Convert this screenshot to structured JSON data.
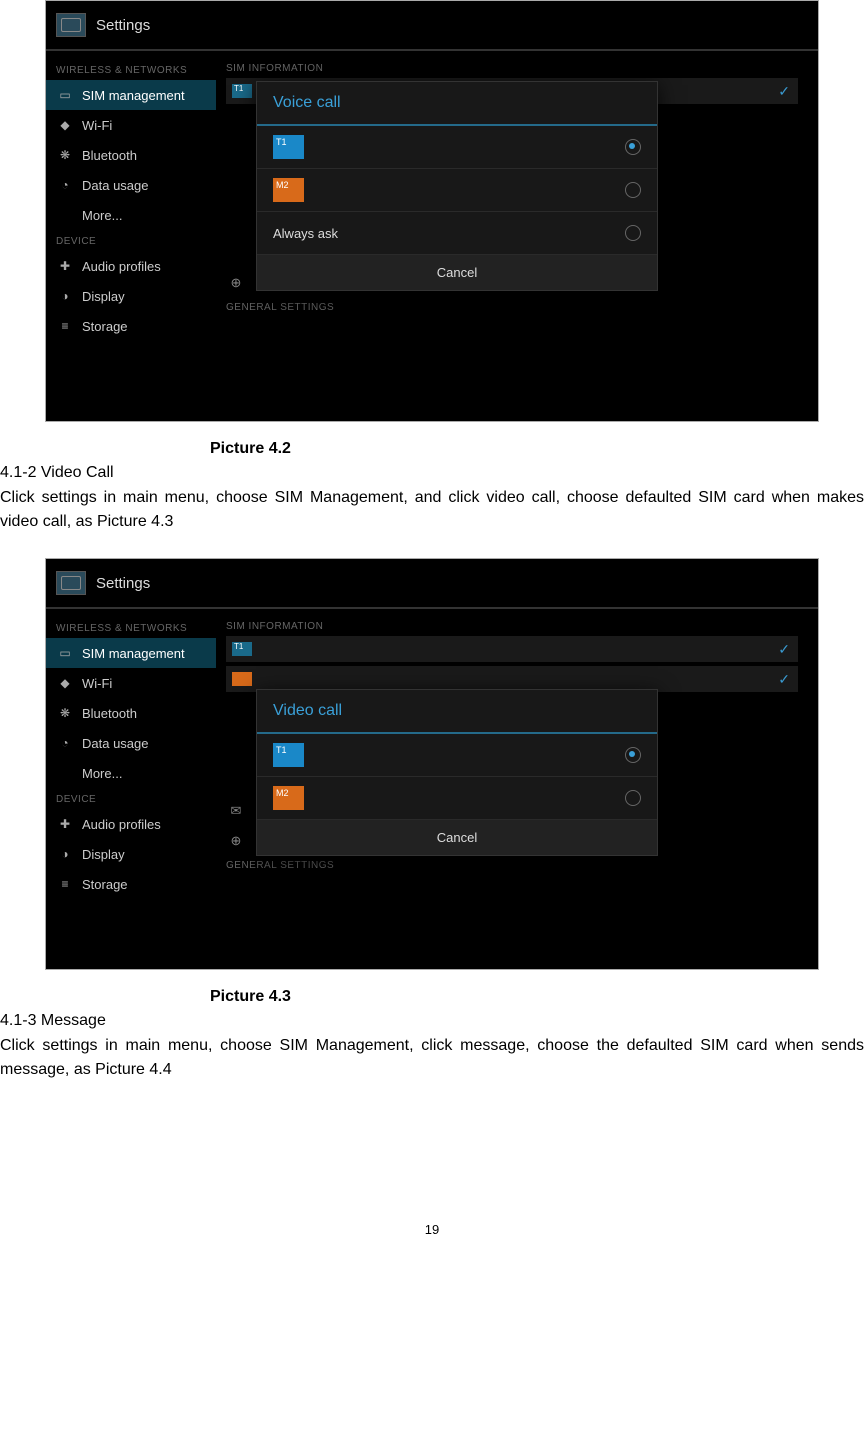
{
  "shot1": {
    "title": "Settings",
    "side_section1": "WIRELESS & NETWORKS",
    "side_items1": [
      "SIM management",
      "Wi-Fi",
      "Bluetooth",
      "Data usage",
      "More..."
    ],
    "side_section2": "DEVICE",
    "side_items2": [
      "Audio profiles",
      "Display",
      "Storage"
    ],
    "right_section": "SIM INFORMATION",
    "right_general": "GENERAL SETTINGS",
    "right_item": "Data connection",
    "dialog": {
      "title": "Voice call",
      "opt1": "T1",
      "opt2": "M2",
      "opt3": "Always ask",
      "cancel": "Cancel"
    }
  },
  "caption1": "Picture 4.2",
  "sect1_head": "4.1-2 Video Call",
  "sect1_body": "Click settings in main menu, choose SIM Management, and click video call, choose defaulted SIM card when makes video call, as Picture 4.3",
  "shot2": {
    "title": "Settings",
    "side_section1": "WIRELESS & NETWORKS",
    "side_items1": [
      "SIM management",
      "Wi-Fi",
      "Bluetooth",
      "Data usage",
      "More..."
    ],
    "side_section2": "DEVICE",
    "side_items2": [
      "Audio profiles",
      "Display",
      "Storage"
    ],
    "right_section": "SIM INFORMATION",
    "right_general": "GENERAL SETTINGS",
    "right_item1": "Messaging",
    "right_item2": "Data connection",
    "dialog": {
      "title": "Video call",
      "opt1": "T1",
      "opt2": "M2",
      "cancel": "Cancel"
    }
  },
  "caption2": "Picture 4.3",
  "sect2_head": "4.1-3 Message",
  "sect2_body": "Click settings in main menu, choose SIM Management, click message, choose the defaulted SIM card when sends message, as Picture 4.4",
  "page_number": "19"
}
